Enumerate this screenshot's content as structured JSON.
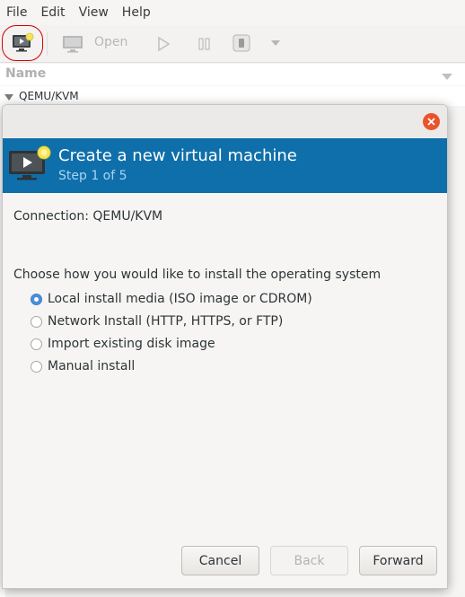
{
  "menubar": {
    "items": [
      "File",
      "Edit",
      "View",
      "Help"
    ]
  },
  "toolbar": {
    "open_label": "Open"
  },
  "list": {
    "column_name": "Name",
    "connection_row": "QEMU/KVM"
  },
  "dialog": {
    "title": "Create a new virtual machine",
    "step": "Step 1 of 5",
    "connection_text": "Connection: QEMU/KVM",
    "question": "Choose how you would like to install the operating system",
    "options": [
      {
        "label": "Local install media (ISO image or CDROM)",
        "selected": true
      },
      {
        "label": "Network Install (HTTP, HTTPS, or FTP)",
        "selected": false
      },
      {
        "label": "Import existing disk image",
        "selected": false
      },
      {
        "label": "Manual install",
        "selected": false
      }
    ],
    "buttons": {
      "cancel": "Cancel",
      "back": "Back",
      "forward": "Forward"
    }
  },
  "colors": {
    "banner": "#0f6faa",
    "close": "#e9542a",
    "radio_selected": "#4a90d9",
    "highlight_ring": "#d40000"
  }
}
